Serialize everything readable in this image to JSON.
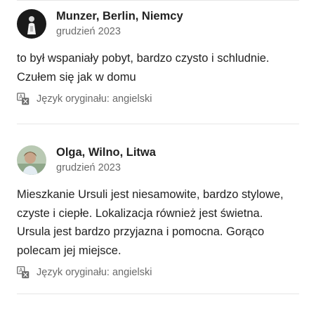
{
  "reviews": [
    {
      "author": "Munzer, Berlin, Niemcy",
      "date": "grudzień 2023",
      "text": "to był wspaniały pobyt, bardzo czysto i schludnie. Czułem się jak w domu",
      "language_note": "Język oryginału: angielski",
      "avatar_icon": "person-photo-icon"
    },
    {
      "author": "Olga, Wilno, Litwa",
      "date": "grudzień 2023",
      "text": "Mieszkanie Ursuli jest niesamowite, bardzo stylowe, czyste i ciepłe. Lokalizacja również jest świetna. Ursula jest bardzo przyjazna i pomocna. Gorąco polecam jej miejsce.",
      "language_note": "Język oryginału: angielski",
      "avatar_icon": "person-photo-icon"
    }
  ],
  "icons": {
    "translate": "translate-icon"
  },
  "colors": {
    "text": "#222222",
    "secondary_text": "#6a6a6a",
    "divider": "#e6e6e6"
  }
}
